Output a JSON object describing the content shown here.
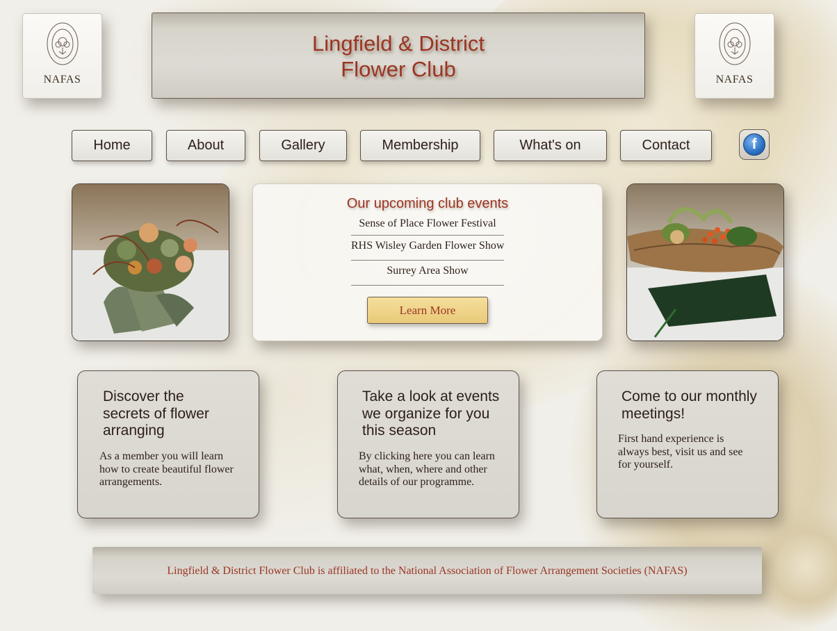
{
  "header": {
    "title_line1": "Lingfield & District",
    "title_line2": "Flower Club",
    "logo_left_text": "NAFAS",
    "logo_right_text": "NAFAS"
  },
  "nav": {
    "items": [
      "Home",
      "About",
      "Gallery",
      "Membership",
      "What's on",
      "Contact"
    ],
    "facebook_icon": "facebook-icon"
  },
  "events": {
    "heading": "Our upcoming club events",
    "items": [
      "Sense of Place Flower Festival",
      "RHS Wisley Garden Flower Show",
      "Surrey Area Show"
    ],
    "button_label": "Learn More"
  },
  "cards": [
    {
      "title": "Discover the secrets of flower arranging",
      "text": "As a member you will learn how to create beautiful flower arrangements."
    },
    {
      "title": "Take a look at events we organize for you this season",
      "text": "By clicking here you can learn what, when, where and other details of our programme."
    },
    {
      "title": "Come to our monthly meetings!",
      "text": "First hand experience is always best, visit us and see for yourself."
    }
  ],
  "footer": {
    "text": "Lingfield & District Flower Club is affiliated to the National Association of Flower Arrangement Societies (NAFAS)"
  },
  "colors": {
    "accent": "#9b3523",
    "button_gold": "#eed38a",
    "background": "#f1efe9"
  }
}
